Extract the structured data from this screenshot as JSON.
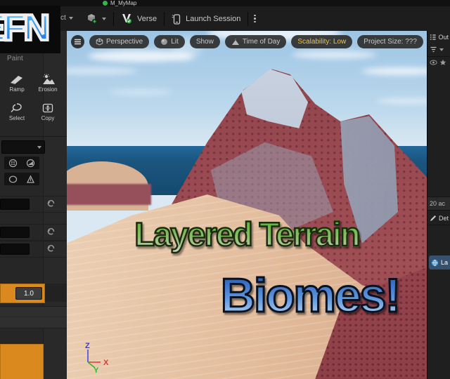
{
  "tab": {
    "label": "M_MyMap"
  },
  "toolbar": {
    "select_partial": "ct",
    "verse_label": "Verse",
    "launch_label": "Launch Session"
  },
  "logo": {
    "text": "EFN"
  },
  "left_panel": {
    "mode_label": "Paint",
    "tools": [
      {
        "label": "Ramp"
      },
      {
        "label": "Erosion"
      },
      {
        "label": "Select"
      },
      {
        "label": "Copy"
      }
    ],
    "strength_value": "1.0"
  },
  "viewport_toolbar": {
    "perspective": "Perspective",
    "lit": "Lit",
    "show": "Show",
    "time_of_day": "Time of Day",
    "scalability": "Scalability: Low",
    "project_size": "Project Size: ???"
  },
  "overlay": {
    "line1": "Layered Terrain",
    "line2": "Biomes!"
  },
  "gizmo": {
    "x": "X",
    "y": "Y",
    "z": "Z"
  },
  "right_panel": {
    "outliner_title": "Out",
    "actor_count": "20 ac",
    "details_title": "Det",
    "selected_actor": "La"
  },
  "colors": {
    "accent_orange": "#d9891e",
    "selection_blue": "#2f7bd9",
    "scalability_yellow": "#f3c33c",
    "title_green": "#4db527",
    "title_blue": "#1d50b4",
    "logo_blue": "#2f9bf0"
  }
}
